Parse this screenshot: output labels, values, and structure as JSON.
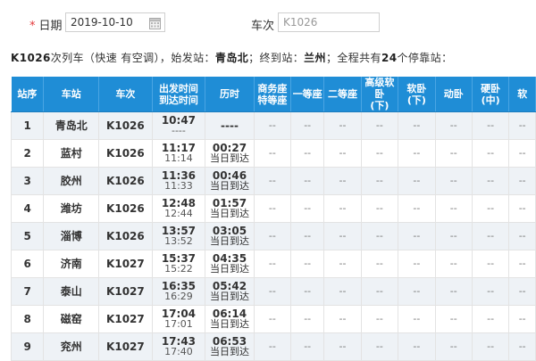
{
  "search": {
    "required_mark": "*",
    "date_label": "日期",
    "date_value": "2019-10-10",
    "train_label": "车次",
    "train_placeholder": "K1026",
    "calendar_icon": "calendar-icon"
  },
  "summary": {
    "train": "K1026",
    "prefix": "次列车（快速 有空调），始发站：",
    "origin": "青岛北",
    "mid": "；终到站：",
    "terminus": "兰州",
    "suffix1": "；全程共有",
    "stop_count": "24",
    "suffix2": "个停靠站："
  },
  "table": {
    "headers": [
      {
        "key": "no",
        "label": "站序"
      },
      {
        "key": "station",
        "label": "车站"
      },
      {
        "key": "train",
        "label": "车次"
      },
      {
        "key": "time",
        "label": "出发时间\n到达时间"
      },
      {
        "key": "duration",
        "label": "历时"
      },
      {
        "key": "business",
        "label": "商务座\n特等座"
      },
      {
        "key": "first",
        "label": "一等座"
      },
      {
        "key": "second",
        "label": "二等座"
      },
      {
        "key": "deluxe",
        "label": "高级软\n卧\n(下)"
      },
      {
        "key": "soft",
        "label": "软卧\n(下)"
      },
      {
        "key": "bed",
        "label": "动卧"
      },
      {
        "key": "hardsleeper",
        "label": "硬卧\n(中)"
      },
      {
        "key": "extra",
        "label": "软"
      }
    ],
    "rows": [
      {
        "no": "1",
        "station": "青岛北",
        "train": "K1026",
        "dep": "10:47",
        "arr": "----",
        "dur": "----",
        "note": ""
      },
      {
        "no": "2",
        "station": "蓝村",
        "train": "K1026",
        "dep": "11:17",
        "arr": "11:14",
        "dur": "00:27",
        "note": "当日到达"
      },
      {
        "no": "3",
        "station": "胶州",
        "train": "K1026",
        "dep": "11:36",
        "arr": "11:33",
        "dur": "00:46",
        "note": "当日到达"
      },
      {
        "no": "4",
        "station": "潍坊",
        "train": "K1026",
        "dep": "12:48",
        "arr": "12:44",
        "dur": "01:57",
        "note": "当日到达"
      },
      {
        "no": "5",
        "station": "淄博",
        "train": "K1026",
        "dep": "13:57",
        "arr": "13:52",
        "dur": "03:05",
        "note": "当日到达"
      },
      {
        "no": "6",
        "station": "济南",
        "train": "K1027",
        "dep": "15:37",
        "arr": "15:22",
        "dur": "04:35",
        "note": "当日到达"
      },
      {
        "no": "7",
        "station": "泰山",
        "train": "K1027",
        "dep": "16:35",
        "arr": "16:29",
        "dur": "05:42",
        "note": "当日到达"
      },
      {
        "no": "8",
        "station": "磁窑",
        "train": "K1027",
        "dep": "17:04",
        "arr": "17:01",
        "dur": "06:14",
        "note": "当日到达"
      },
      {
        "no": "9",
        "station": "兖州",
        "train": "K1027",
        "dep": "17:43",
        "arr": "17:40",
        "dur": "06:53",
        "note": "当日到达"
      }
    ],
    "seat_placeholder": "--"
  },
  "colors": {
    "header_bg": "#1f8dd6",
    "row_alt": "#eef2f6",
    "required": "#e4393c"
  }
}
